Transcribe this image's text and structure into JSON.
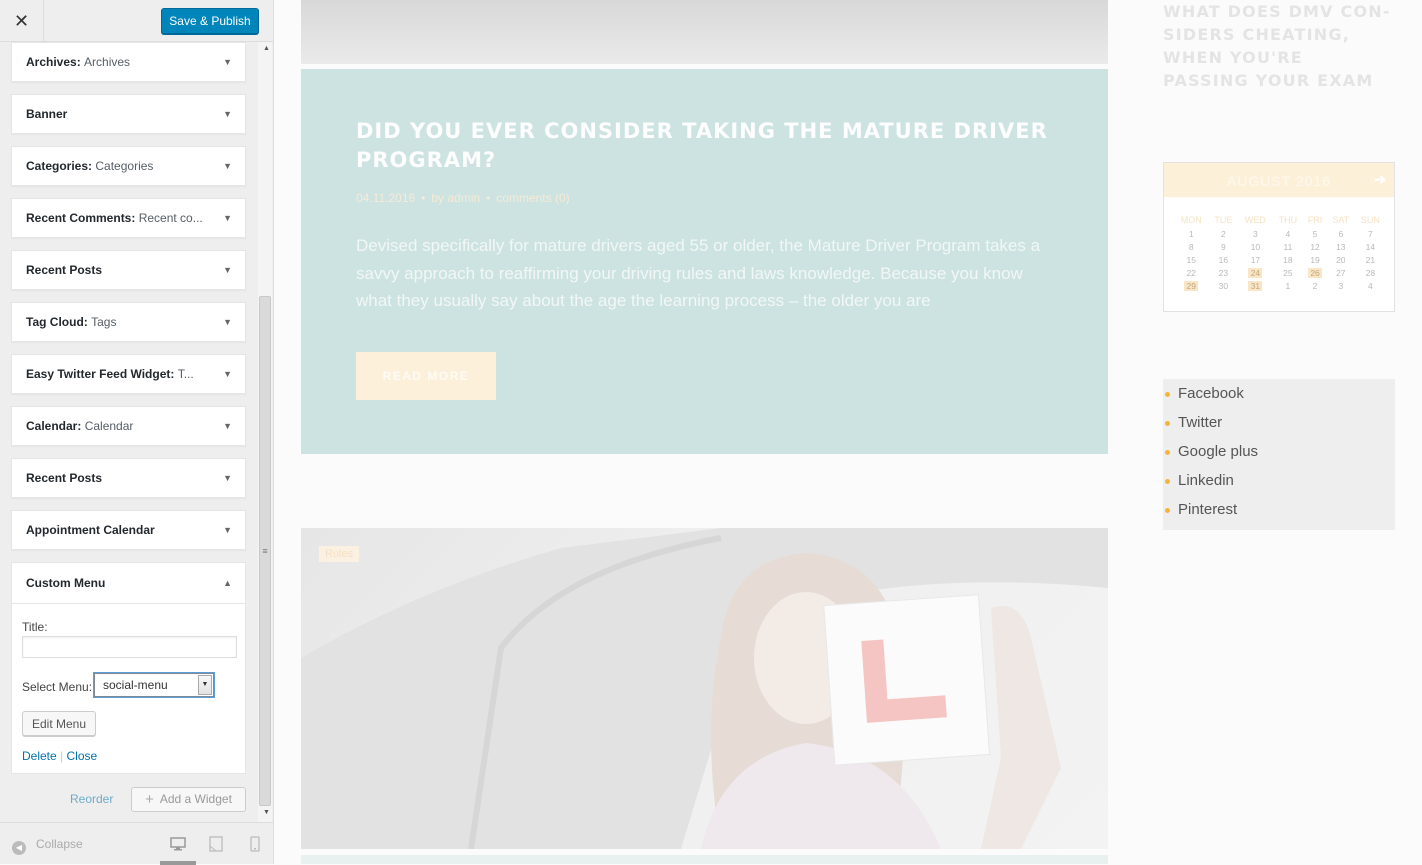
{
  "toolbar": {
    "close_label": "✕",
    "publish_label": "Save & Publish"
  },
  "widgets": [
    {
      "title": "Archives",
      "sub": "Archives"
    },
    {
      "title": "Banner",
      "sub": ""
    },
    {
      "title": "Categories",
      "sub": "Categories"
    },
    {
      "title": "Recent Comments",
      "sub": "Recent co..."
    },
    {
      "title": "Recent Posts",
      "sub": ""
    },
    {
      "title": "Tag Cloud",
      "sub": "Tags"
    },
    {
      "title": "Easy Twitter Feed Widget",
      "sub": "T..."
    },
    {
      "title": "Calendar",
      "sub": "Calendar"
    },
    {
      "title": "Recent Posts",
      "sub": ""
    },
    {
      "title": "Appointment Calendar",
      "sub": ""
    }
  ],
  "custom_menu": {
    "title": "Custom Menu",
    "title_label": "Title:",
    "title_value": "",
    "select_label": "Select Menu:",
    "select_value": "social-menu",
    "edit_label": "Edit Menu",
    "delete_label": "Delete",
    "separator": "|",
    "close_label": "Close"
  },
  "panel_footer": {
    "reorder_label": "Reorder",
    "add_widget_label": "Add a Widget"
  },
  "footer": {
    "collapse_label": "Collapse"
  },
  "post": {
    "title": "DID YOU EVER CONSIDER TAKING THE MATURE DRIVER PROGRAM?",
    "date": "04.11.2016",
    "author": "by admin",
    "comments": "comments (0)",
    "excerpt": "Devised specifically for mature drivers aged 55 or older, the Mature Driver Program takes a savvy approach to reaffirming your driving rules and laws knowledge. Because you know what they usually say about the age the learning process – the older you are",
    "read_more": "READ MORE"
  },
  "photo_tag": "Rules",
  "side_heading": "WHAT DOES DMV CON-SIDERS CHEATING, WHEN YOU'RE PASSING YOUR EXAM",
  "calendar": {
    "month": "AUGUST 2016",
    "days": [
      "MON",
      "TUE",
      "WED",
      "THU",
      "FRI",
      "SAT",
      "SUN"
    ],
    "weeks": [
      [
        "1",
        "2",
        "3",
        "4",
        "5",
        "6",
        "7"
      ],
      [
        "8",
        "9",
        "10",
        "11",
        "12",
        "13",
        "14"
      ],
      [
        "15",
        "16",
        "17",
        "18",
        "19",
        "20",
        "21"
      ],
      [
        "22",
        "23",
        "24",
        "25",
        "26",
        "27",
        "28"
      ],
      [
        "29",
        "30",
        "31",
        "1",
        "2",
        "3",
        "4"
      ]
    ]
  },
  "social_menu": [
    "Facebook",
    "Twitter",
    "Google plus",
    "Linkedin",
    "Pinterest"
  ],
  "colors": {
    "accent": "#0085ba",
    "post_card": "#cce3e1",
    "bullet": "#f4b43c"
  }
}
